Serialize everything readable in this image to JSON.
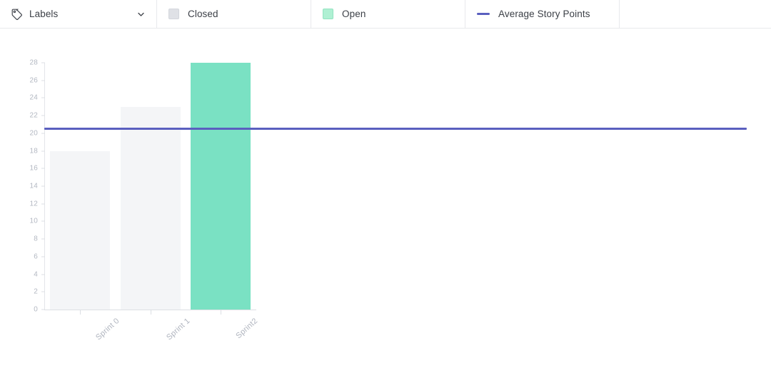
{
  "legend": {
    "labels_filter": {
      "icon": "tag-icon",
      "label": "Labels",
      "chevron": "chevron-down-icon"
    },
    "items": [
      {
        "key": "closed",
        "label": "Closed",
        "marker": "square-swatch",
        "color": "#DFE1E6"
      },
      {
        "key": "open",
        "label": "Open",
        "marker": "square-swatch",
        "color": "#AFF0D3"
      },
      {
        "key": "average",
        "label": "Average Story Points",
        "marker": "line-swatch",
        "color": "#5A5FBF"
      }
    ]
  },
  "chart_data": {
    "type": "bar",
    "title": "",
    "xlabel": "",
    "ylabel": "",
    "categories": [
      "Sprint 0",
      "Sprint 1",
      "Sprint2"
    ],
    "series": [
      {
        "name": "Closed",
        "color": "#F4F5F7",
        "values": [
          18,
          23,
          null
        ]
      },
      {
        "name": "Open",
        "color": "#7AE1C3",
        "values": [
          null,
          null,
          28
        ]
      }
    ],
    "bar_values": [
      18,
      23,
      28
    ],
    "bar_series": [
      "Closed",
      "Closed",
      "Open"
    ],
    "reference_line": {
      "name": "Average Story Points",
      "value": 20.5,
      "color": "#5A5FBF"
    },
    "ylim": [
      0,
      28
    ],
    "ytick_step": 2,
    "yticks": [
      0,
      2,
      4,
      6,
      8,
      10,
      12,
      14,
      16,
      18,
      20,
      22,
      24,
      26,
      28
    ],
    "grid": false,
    "legend_position": "top"
  }
}
